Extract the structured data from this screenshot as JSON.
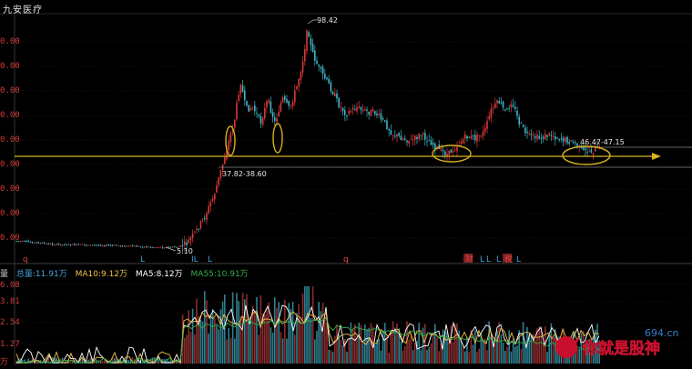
{
  "title": "九安医疗",
  "price_axis": {
    "labels": [
      "0.00",
      "0.00",
      "0.00",
      "0.00",
      "0.00",
      "0.00",
      "0.00",
      "0.00",
      "0.00",
      "0.00"
    ]
  },
  "volume_axis": {
    "labels": [
      "6.08",
      "3.81",
      "2.54",
      "1.27",
      "万"
    ]
  },
  "annotations": {
    "high": "98.42",
    "low": "5.10",
    "support_range": "37.82-38.60",
    "current_range": "46.47-47.15"
  },
  "markers": [
    {
      "text": "q",
      "color": "#e04444"
    },
    {
      "text": "L",
      "color": "#3fa3e0"
    },
    {
      "text": "IL",
      "color": "#3fa3e0"
    },
    {
      "text": "L",
      "color": "#3fa3e0"
    },
    {
      "text": "q",
      "color": "#e04444"
    },
    {
      "text": "财",
      "color": "#e04444"
    },
    {
      "text": "L",
      "color": "#3fa3e0"
    },
    {
      "text": "L",
      "color": "#3fa3e0"
    },
    {
      "text": "L",
      "color": "#3fa3e0"
    },
    {
      "text": "税",
      "color": "#e04444"
    },
    {
      "text": "L",
      "color": "#3fa3e0"
    }
  ],
  "legend": {
    "prefix": "量",
    "total": "总量:11.91万",
    "ma10": "MA10:9.12万",
    "ma5": "MA5:8.12万",
    "ma55": "MA55:10.91万"
  },
  "colors": {
    "up": "#d93a3a",
    "down": "#3fb6c8",
    "support": "#d9b21e",
    "ma5": "#ffffff",
    "ma10": "#f2c14a",
    "ma55": "#30b04a"
  },
  "watermark": {
    "site": "694.cn",
    "brand": "你就是股神"
  }
}
